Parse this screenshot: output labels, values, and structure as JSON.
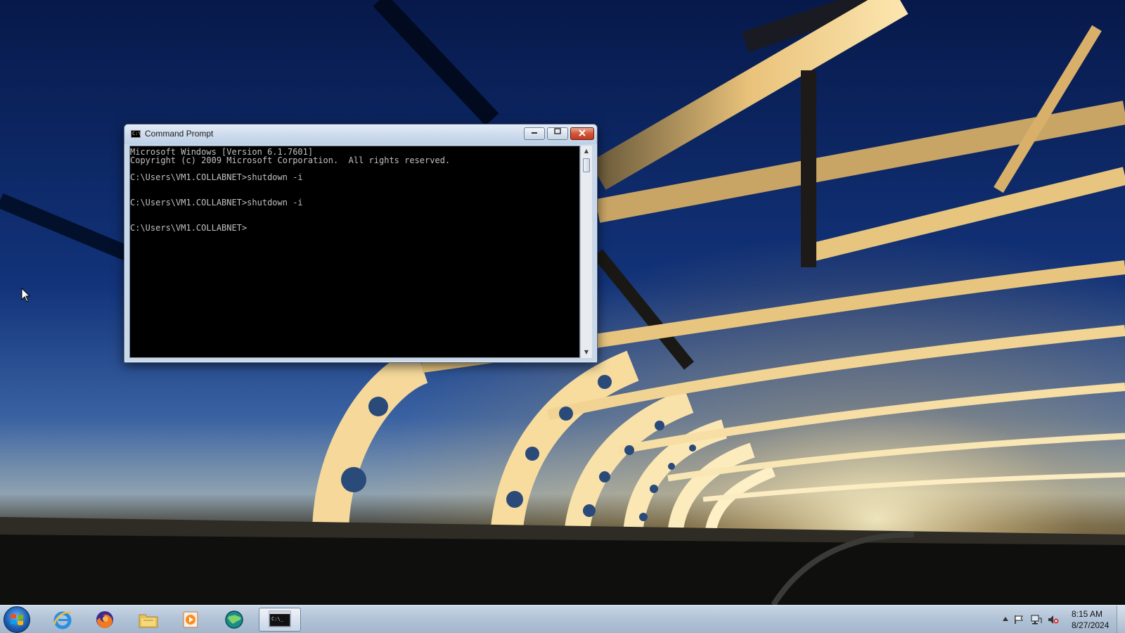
{
  "window": {
    "title": "Command Prompt",
    "app_icon": "cmd-icon",
    "controls": {
      "minimize_icon": "minimize-icon",
      "maximize_icon": "maximize-icon",
      "close_icon": "close-icon"
    }
  },
  "console": {
    "lines": [
      "Microsoft Windows [Version 6.1.7601]",
      "Copyright (c) 2009 Microsoft Corporation.  All rights reserved.",
      "",
      "C:\\Users\\VM1.COLLABNET>shutdown -i",
      "",
      "",
      "C:\\Users\\VM1.COLLABNET>shutdown -i",
      "",
      "",
      "C:\\Users\\VM1.COLLABNET>"
    ],
    "background": "#000000",
    "text_color": "#c0c0c0"
  },
  "taskbar": {
    "start_icon": "windows-logo-icon",
    "pinned": [
      {
        "name": "internet-explorer",
        "icon": "internet-explorer-icon"
      },
      {
        "name": "firefox",
        "icon": "firefox-icon"
      },
      {
        "name": "file-explorer",
        "icon": "folder-icon"
      },
      {
        "name": "media-player",
        "icon": "media-player-icon"
      },
      {
        "name": "globe-app",
        "icon": "globe-icon"
      },
      {
        "name": "command-prompt",
        "icon": "cmd-icon",
        "active": true
      }
    ],
    "tray": {
      "icons": [
        "show-hidden-icons-arrow",
        "action-center-flag-icon",
        "network-icon",
        "volume-muted-icon"
      ],
      "time": "8:15 AM",
      "date": "8/27/2024"
    }
  }
}
